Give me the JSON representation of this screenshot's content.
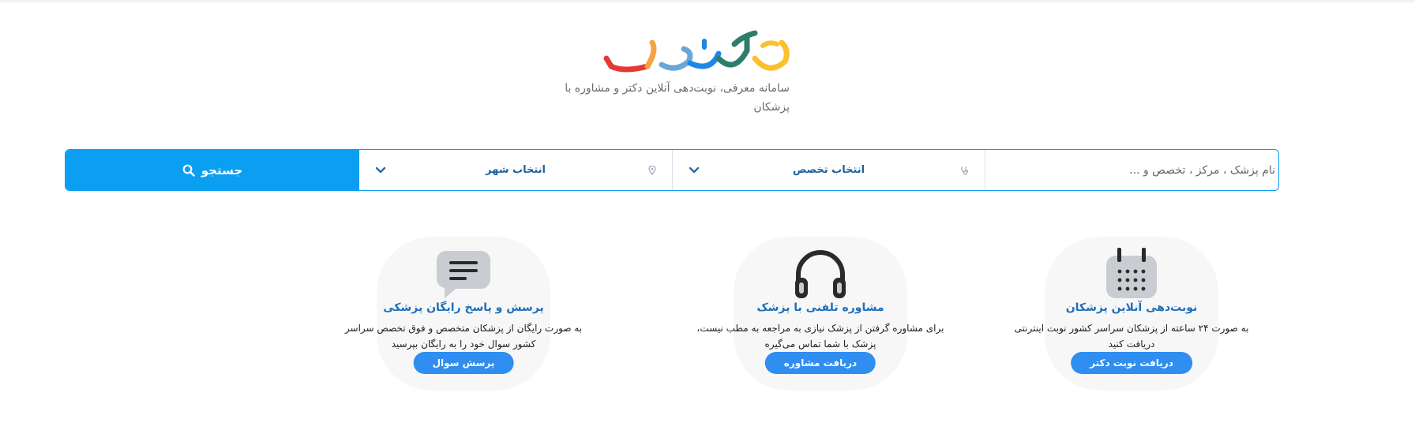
{
  "header": {
    "logo_name": "logo",
    "tagline": "سامانه معرفی، نوبت‌دهی آنلاین دکتر و مشاوره با پزشکان"
  },
  "search": {
    "input_placeholder": "نام پزشک ، مرکز ، تخصص و ...",
    "specialty_label": "انتخاب تخصص",
    "city_label": "انتخاب شهر",
    "button_label": "جستجو",
    "accent_color": "#0b9ff2"
  },
  "features": [
    {
      "icon": "calendar-icon",
      "title": "نوبت‌دهی آنلاین پزشکان",
      "desc": "به صورت ۲۴ ساعته از پزشکان سراسر کشور نوبت اینترنتی دریافت کنید",
      "button": "دریافت نوبت دکتر"
    },
    {
      "icon": "headphones-icon",
      "title": "مشاوره تلفنی با پزشک",
      "desc": "برای مشاوره گرفتن از پزشک نیازی به مراجعه به مطب نیست، پزشک با شما تماس می‌گیره",
      "button": "دریافت مشاوره"
    },
    {
      "icon": "chat-bubble-icon",
      "title": "پرسش و پاسخ رایگان پزشکی",
      "desc": "به صورت رایگان از پزشکان متخصص و فوق تخصص سراسر کشور سوال خود را به رایگان بپرسید",
      "button": "پرسش سوال"
    }
  ]
}
